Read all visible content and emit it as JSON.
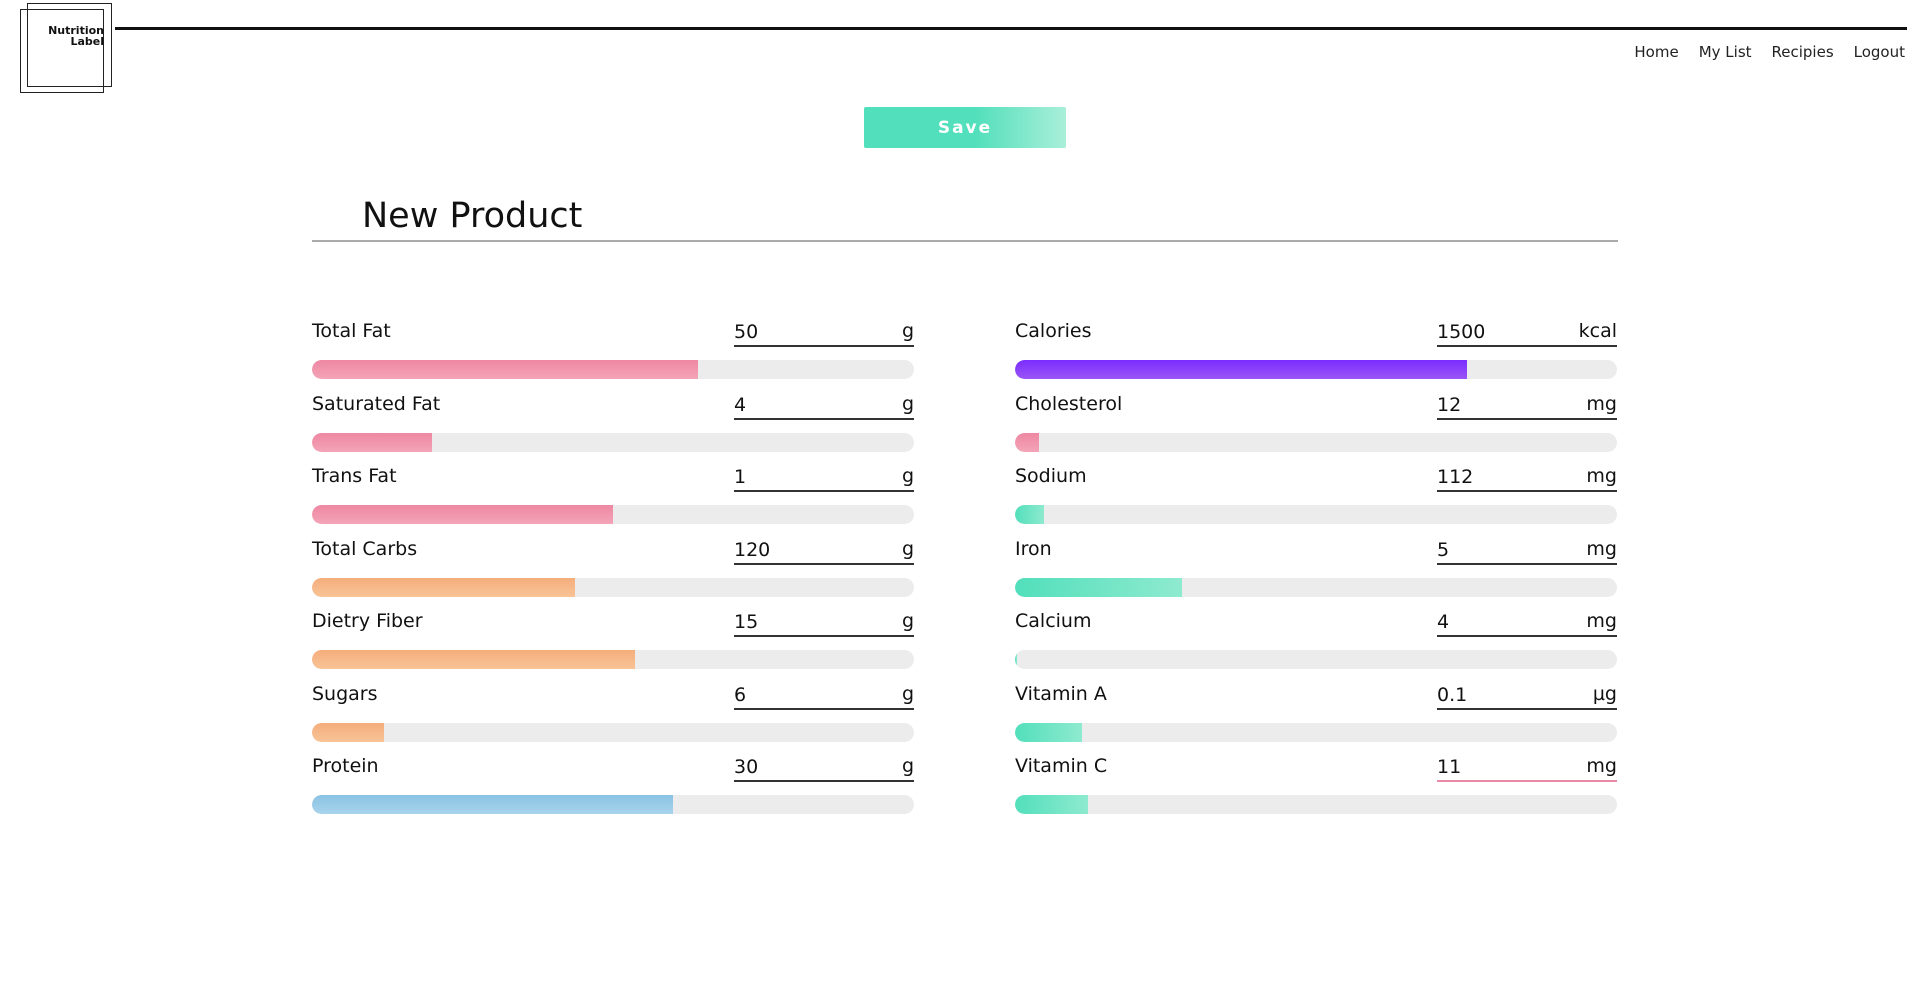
{
  "logo": {
    "line1": "Nutrition",
    "line2": "Label"
  },
  "nav": [
    {
      "label": "Home"
    },
    {
      "label": "My List"
    },
    {
      "label": "Recipies"
    },
    {
      "label": "Logout"
    }
  ],
  "save_label": "Save",
  "title": "New Product",
  "colors": {
    "save_button": "#52dfbb",
    "fat": "#ee87a2",
    "carbs": "#f5ad7c",
    "protein": "#8ac3e3",
    "calories": "#7b2dff",
    "micros": "#52dfbb",
    "track": "#ececec"
  },
  "left": [
    {
      "label": "Total Fat",
      "value": "50",
      "unit": "g",
      "fill": 0.642,
      "color": "pink"
    },
    {
      "label": "Saturated Fat",
      "value": "4",
      "unit": "g",
      "fill": 0.2,
      "color": "pink"
    },
    {
      "label": "Trans Fat",
      "value": "1",
      "unit": "g",
      "fill": 0.5,
      "color": "pink"
    },
    {
      "label": "Total Carbs",
      "value": "120",
      "unit": "g",
      "fill": 0.437,
      "color": "orange"
    },
    {
      "label": "Dietry Fiber",
      "value": "15",
      "unit": "g",
      "fill": 0.536,
      "color": "orange"
    },
    {
      "label": "Sugars",
      "value": "6",
      "unit": "g",
      "fill": 0.12,
      "color": "orange"
    },
    {
      "label": "Protein",
      "value": "30",
      "unit": "g",
      "fill": 0.6,
      "color": "blue"
    }
  ],
  "right": [
    {
      "label": "Calories",
      "value": "1500",
      "unit": "kcal",
      "fill": 0.75,
      "color": "purple"
    },
    {
      "label": "Cholesterol",
      "value": "12",
      "unit": "mg",
      "fill": 0.04,
      "color": "pink"
    },
    {
      "label": "Sodium",
      "value": "112",
      "unit": "mg",
      "fill": 0.049,
      "color": "teal"
    },
    {
      "label": "Iron",
      "value": "5",
      "unit": "mg",
      "fill": 0.278,
      "color": "teal"
    },
    {
      "label": "Calcium",
      "value": "4",
      "unit": "mg",
      "fill": 0.004,
      "color": "teal"
    },
    {
      "label": "Vitamin A",
      "value": "0.1",
      "unit": "µg",
      "fill": 0.111,
      "color": "teal"
    },
    {
      "label": "Vitamin C",
      "value": "11",
      "unit": "mg",
      "fill": 0.122,
      "color": "teal",
      "active": true
    }
  ]
}
